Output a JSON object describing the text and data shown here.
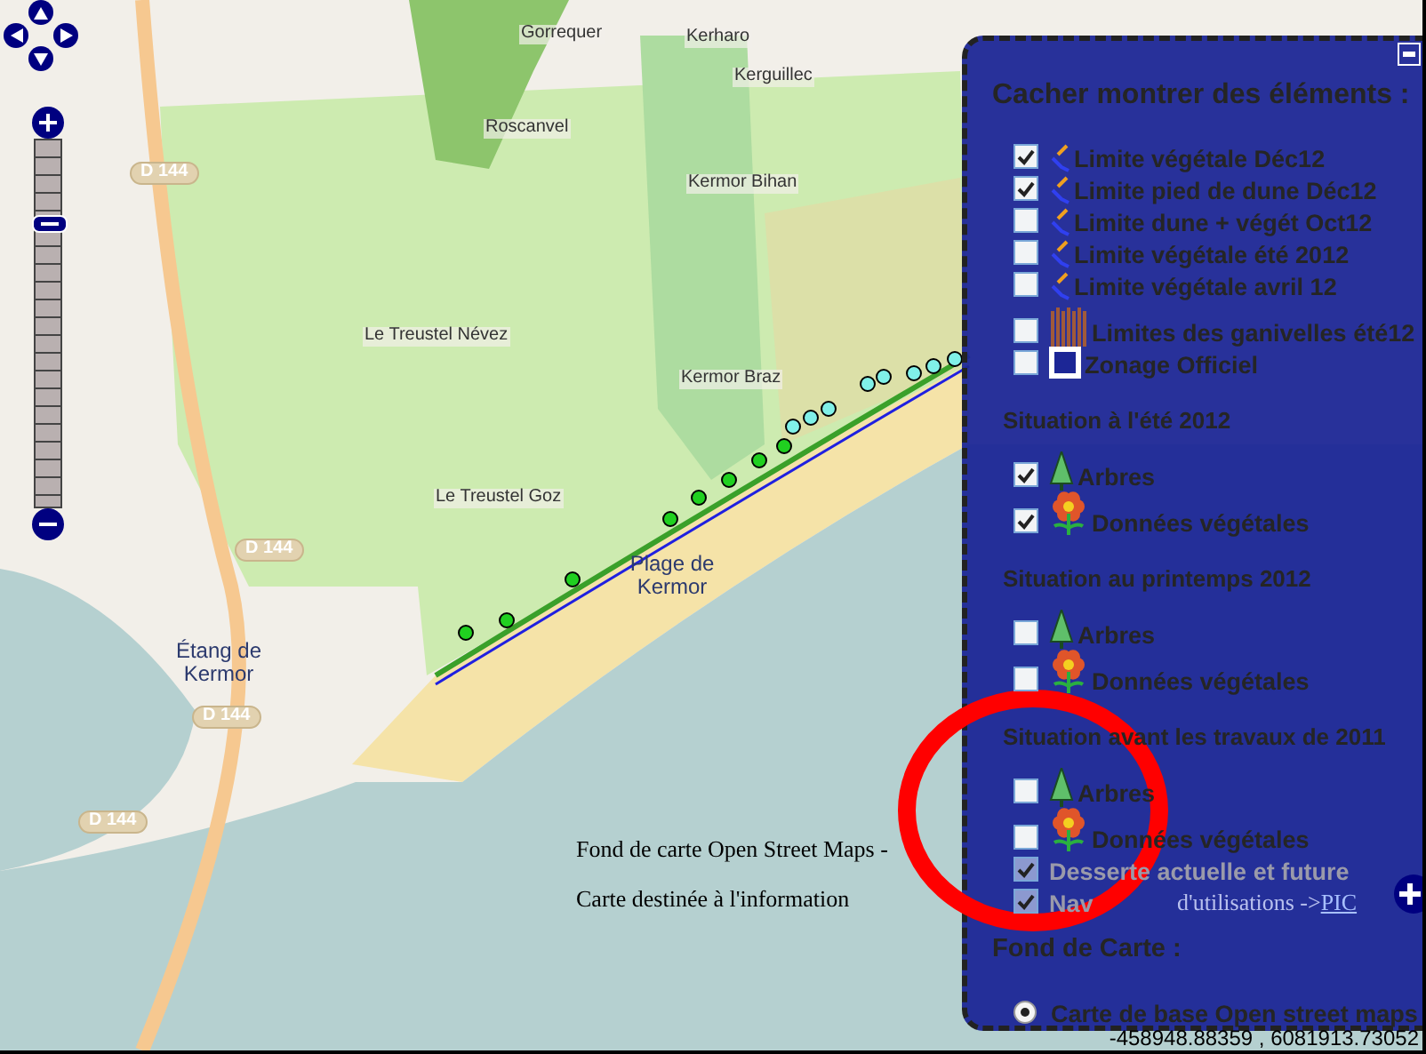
{
  "map": {
    "labels": [
      {
        "text": "Gorrequer",
        "kind": "place"
      },
      {
        "text": "Kerharo",
        "kind": "place"
      },
      {
        "text": "Kerguillec",
        "kind": "place"
      },
      {
        "text": "Roscanvel",
        "kind": "place"
      },
      {
        "text": "Kermor Bihan",
        "kind": "place"
      },
      {
        "text": "Le Treustel Névez",
        "kind": "place"
      },
      {
        "text": "Kermor Braz",
        "kind": "place"
      },
      {
        "text": "Le Treustel Goz",
        "kind": "place"
      },
      {
        "text": "Plage de Kermor",
        "kind": "water"
      },
      {
        "text": "Étang de Kermor",
        "kind": "water"
      },
      {
        "text": "D 144",
        "kind": "road"
      },
      {
        "text": "D 144",
        "kind": "road"
      },
      {
        "text": "D 144",
        "kind": "road"
      },
      {
        "text": "D 144",
        "kind": "road"
      }
    ]
  },
  "zoom_bar": {
    "level": 0.77
  },
  "notes": [
    "Fond de carte Open Street Maps -",
    "Carte destinée à l'information"
  ],
  "terms": {
    "text": "d'utilisations ->",
    "link": "PIC"
  },
  "layer_switcher": {
    "title": "Cacher montrer des éléments :",
    "groups": [
      {
        "items": [
          {
            "label": "Limite végétale Déc12",
            "kind": "line",
            "checked": true,
            "disabled": false
          },
          {
            "label": "Limite pied de dune Déc12",
            "kind": "line",
            "checked": true,
            "disabled": false
          },
          {
            "label": "Limite dune + végét Oct12",
            "kind": "line",
            "checked": false,
            "disabled": false
          },
          {
            "label": "Limite végétale été 2012",
            "kind": "line",
            "checked": false,
            "disabled": false
          },
          {
            "label": "Limite végétale avril 12",
            "kind": "line",
            "checked": false,
            "disabled": false
          },
          {
            "label": "Limites des ganivelles été12",
            "kind": "fence",
            "checked": false,
            "disabled": false
          },
          {
            "label": "Zonage Officiel",
            "kind": "zone",
            "checked": false,
            "disabled": false
          }
        ]
      },
      {
        "heading": "Situation à l'été 2012",
        "items": [
          {
            "label": "Arbres",
            "kind": "tree",
            "checked": true,
            "disabled": false
          },
          {
            "label": "Données végétales",
            "kind": "flower",
            "checked": true,
            "disabled": false
          }
        ]
      },
      {
        "heading": "Situation au printemps 2012",
        "items": [
          {
            "label": "Arbres",
            "kind": "tree",
            "checked": false,
            "disabled": false
          },
          {
            "label": "Données végétales",
            "kind": "flower",
            "checked": false,
            "disabled": false
          }
        ]
      },
      {
        "heading": "Situation avant les travaux de 2011",
        "items": [
          {
            "label": "Arbres",
            "kind": "tree",
            "checked": false,
            "disabled": false
          },
          {
            "label": "Données végétales",
            "kind": "flower",
            "checked": false,
            "disabled": false
          },
          {
            "label": "Desserte actuelle et future",
            "kind": "plain",
            "checked": true,
            "disabled": true
          },
          {
            "label": "Nav",
            "kind": "plain",
            "checked": true,
            "disabled": true
          }
        ]
      }
    ],
    "base_heading": "Fond de Carte :",
    "base_layers": [
      {
        "label": "Carte de base Open street maps",
        "selected": true
      }
    ]
  },
  "coordinates": "-458948.88359 , 6081913.73052"
}
